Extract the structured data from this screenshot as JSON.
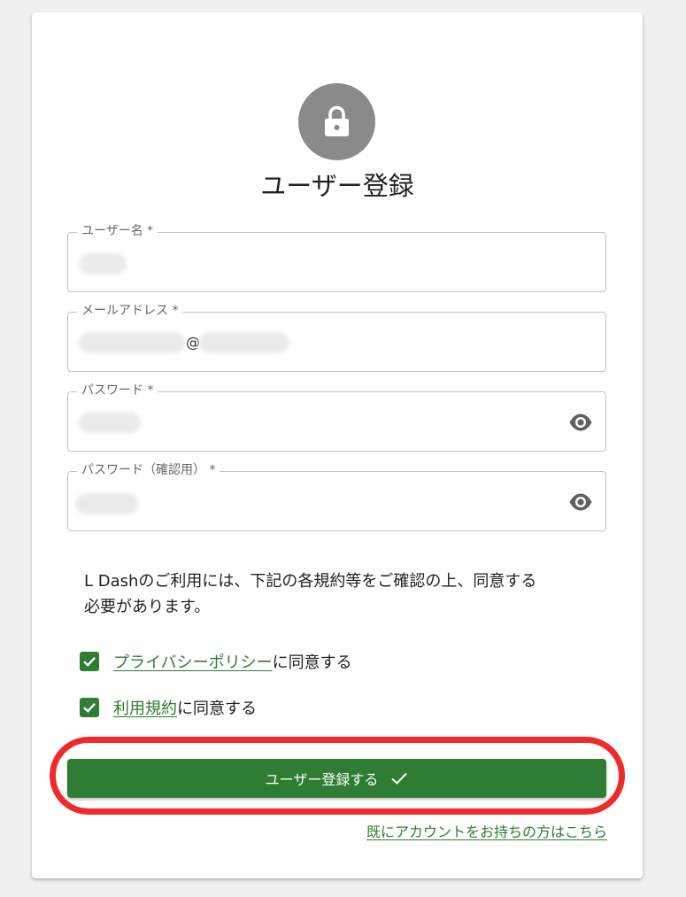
{
  "form": {
    "title": "ユーザー登録",
    "username": {
      "label": "ユーザー名 *",
      "value_hidden": true
    },
    "email": {
      "label": "メールアドレス *",
      "at_sign": "@"
    },
    "password": {
      "label": "パスワード *",
      "toggle_icon": "visibility-icon"
    },
    "password_confirm": {
      "label": "パスワード（確認用） *",
      "toggle_icon": "visibility-icon"
    }
  },
  "notice": {
    "line1": "L Dashのご利用には、下記の各規約等をご確認の上、同意する",
    "line2": "必要があります。"
  },
  "agreements": [
    {
      "link": "プライバシーポリシー",
      "suffix": "に同意する",
      "checked": true
    },
    {
      "link": "利用規約",
      "suffix": "に同意する",
      "checked": true
    }
  ],
  "submit": {
    "label": "ユーザー登録する",
    "icon": "check-icon"
  },
  "login_link": "既にアカウントをお持ちの方はこちら",
  "colors": {
    "accent": "#2e7d32",
    "highlight": "#f02a2a",
    "avatar": "#8a8a8a"
  }
}
